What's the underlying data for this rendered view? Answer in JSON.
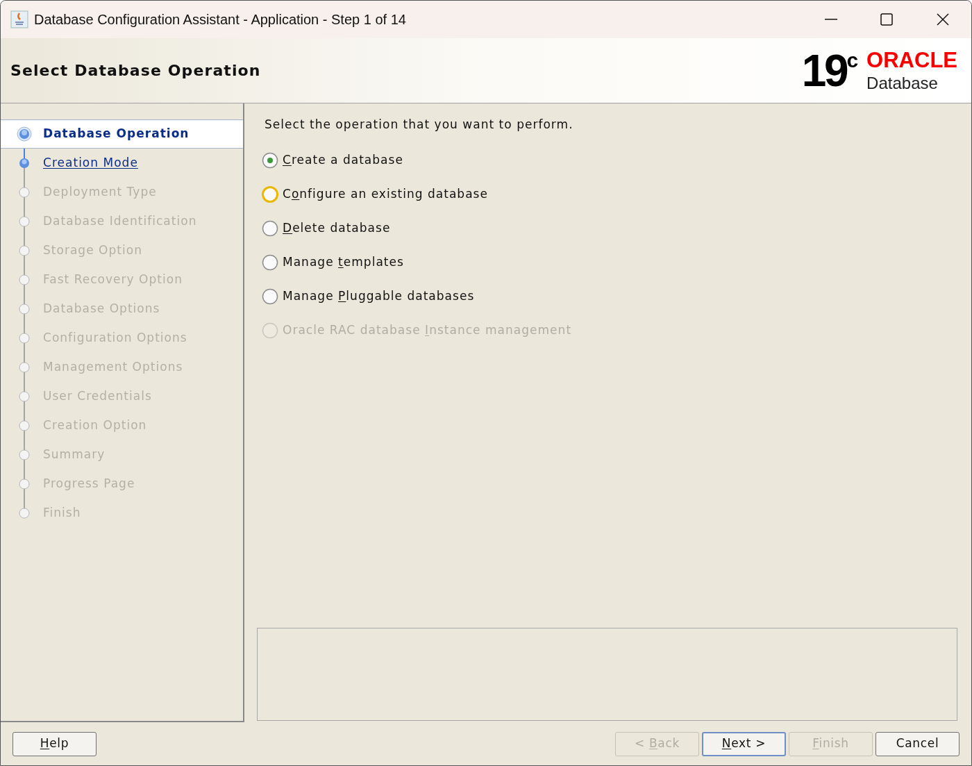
{
  "window": {
    "title": "Database Configuration Assistant - Application - Step 1 of 14"
  },
  "header": {
    "title": "Select Database Operation",
    "logo_version": "19",
    "logo_suffix": "c",
    "logo_brand": "ORACLE",
    "logo_product": "Database"
  },
  "steps": [
    {
      "label": "Database Operation",
      "kind": "current",
      "selected": true
    },
    {
      "label": "Creation Mode",
      "kind": "link",
      "selected": false
    },
    {
      "label": "Deployment Type",
      "kind": "pending",
      "selected": false
    },
    {
      "label": "Database Identification",
      "kind": "pending",
      "selected": false
    },
    {
      "label": "Storage Option",
      "kind": "pending",
      "selected": false
    },
    {
      "label": "Fast Recovery Option",
      "kind": "pending",
      "selected": false
    },
    {
      "label": "Database Options",
      "kind": "pending",
      "selected": false
    },
    {
      "label": "Configuration Options",
      "kind": "pending",
      "selected": false
    },
    {
      "label": "Management Options",
      "kind": "pending",
      "selected": false
    },
    {
      "label": "User Credentials",
      "kind": "pending",
      "selected": false
    },
    {
      "label": "Creation Option",
      "kind": "pending",
      "selected": false
    },
    {
      "label": "Summary",
      "kind": "pending",
      "selected": false
    },
    {
      "label": "Progress Page",
      "kind": "pending",
      "selected": false
    },
    {
      "label": "Finish",
      "kind": "pending",
      "selected": false
    }
  ],
  "prompt": "Select the operation that you want to perform.",
  "options": [
    {
      "key": "C",
      "post": "reate a database",
      "selected": true,
      "focused": false,
      "disabled": false
    },
    {
      "pre": "C",
      "key": "o",
      "post": "nfigure an existing database",
      "selected": false,
      "focused": true,
      "disabled": false
    },
    {
      "key": "D",
      "post": "elete database",
      "selected": false,
      "focused": false,
      "disabled": false
    },
    {
      "pre": "Manage ",
      "key": "t",
      "post": "emplates",
      "selected": false,
      "focused": false,
      "disabled": false
    },
    {
      "pre": "Manage ",
      "key": "P",
      "post": "luggable databases",
      "selected": false,
      "focused": false,
      "disabled": false
    },
    {
      "pre": "Oracle RAC database ",
      "key": "I",
      "post": "nstance management",
      "selected": false,
      "focused": false,
      "disabled": true
    }
  ],
  "buttons": [
    {
      "key": "H",
      "post": "elp",
      "disabled": false,
      "default": false
    },
    {
      "pre": "< ",
      "key": "B",
      "post": "ack",
      "disabled": true,
      "default": false
    },
    {
      "key": "N",
      "post": "ext >",
      "disabled": false,
      "default": true
    },
    {
      "key": "F",
      "post": "inish",
      "disabled": true,
      "default": false
    },
    {
      "pre": "Cancel",
      "disabled": false,
      "default": false
    }
  ]
}
